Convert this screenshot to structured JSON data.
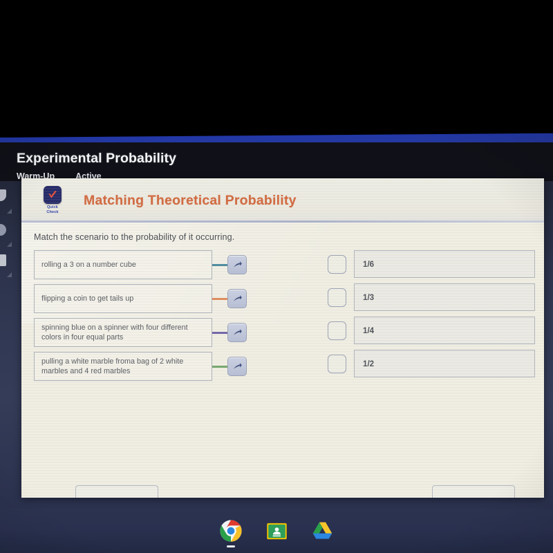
{
  "browser": {
    "page_title": "Experimental Probability",
    "breadcrumbs": [
      {
        "label": "Warm-Up"
      },
      {
        "label": "Active"
      }
    ],
    "left_rail_icons": [
      "back-icon",
      "refresh-icon",
      "bookmark-icon"
    ]
  },
  "card": {
    "badge": {
      "icon": "check-mark-icon",
      "label_line1": "Quick",
      "label_line2": "Check"
    },
    "title": "Matching Theoretical Probability",
    "instruction": "Match the scenario to the probability of it occurring.",
    "scenarios": [
      {
        "text": "rolling a 3 on a number cube",
        "connector_color": "#4b8b9e",
        "handle_icon": "arrow-up-right-icon"
      },
      {
        "text": "flipping a coin to get tails up",
        "connector_color": "#e08a5a",
        "handle_icon": "arrow-up-right-icon"
      },
      {
        "text": "spinning blue on a spinner with four different colors in four equal parts",
        "connector_color": "#6f63a8",
        "handle_icon": "arrow-up-right-icon"
      },
      {
        "text": "pulling a white marble froma bag of 2 white marbles and 4 red marbles",
        "connector_color": "#77a86f",
        "handle_icon": "arrow-up-right-icon"
      }
    ],
    "probabilities": [
      {
        "value": "1/6",
        "drop_target": "empty"
      },
      {
        "value": "1/3",
        "drop_target": "empty"
      },
      {
        "value": "1/4",
        "drop_target": "empty"
      },
      {
        "value": "1/2",
        "drop_target": "empty"
      }
    ],
    "footer_buttons": [
      {
        "label": ""
      },
      {
        "label": ""
      }
    ]
  },
  "shelf": {
    "icons": [
      {
        "name": "chrome-icon"
      },
      {
        "name": "google-classroom-icon"
      },
      {
        "name": "google-drive-icon"
      }
    ]
  },
  "colors": {
    "title_orange": "#d2693f",
    "header_blue": "#2238a8",
    "badge_navy": "#252a68",
    "badge_check_red": "#e5503a"
  }
}
